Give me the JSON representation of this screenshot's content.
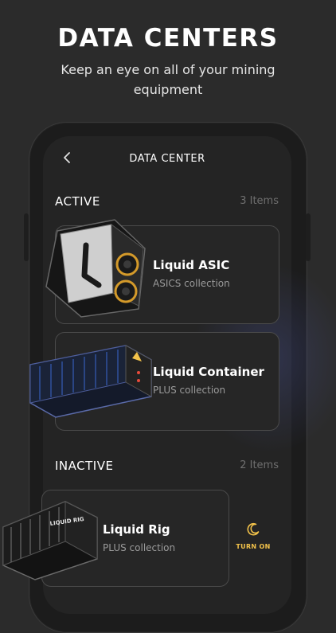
{
  "hero": {
    "title": "DATA CENTERS",
    "subtitle": "Keep an eye on all of your mining equipment"
  },
  "nav": {
    "back_icon": "chevron-left-icon",
    "title": "DATA CENTER"
  },
  "active": {
    "title": "ACTIVE",
    "count": "3 Items",
    "items": [
      {
        "name": "Liquid ASIC",
        "collection": "ASICS collection",
        "icon": "asic-device-icon"
      },
      {
        "name": "Liquid Container",
        "collection": "PLUS collection",
        "icon": "container-device-icon"
      }
    ]
  },
  "inactive": {
    "title": "INACTIVE",
    "count": "2 Items",
    "items": [
      {
        "name": "Liquid Rig",
        "collection": "PLUS collection",
        "icon": "rig-device-icon",
        "rig_label": "LIQUID RIG",
        "action": "TURN ON",
        "action_icon": "moon-icon"
      }
    ]
  },
  "colors": {
    "background": "#2b2b2b",
    "screen": "#242424",
    "card_border": "#4a4a4a",
    "accent": "#f2c24a",
    "muted": "#6f6f6f"
  }
}
